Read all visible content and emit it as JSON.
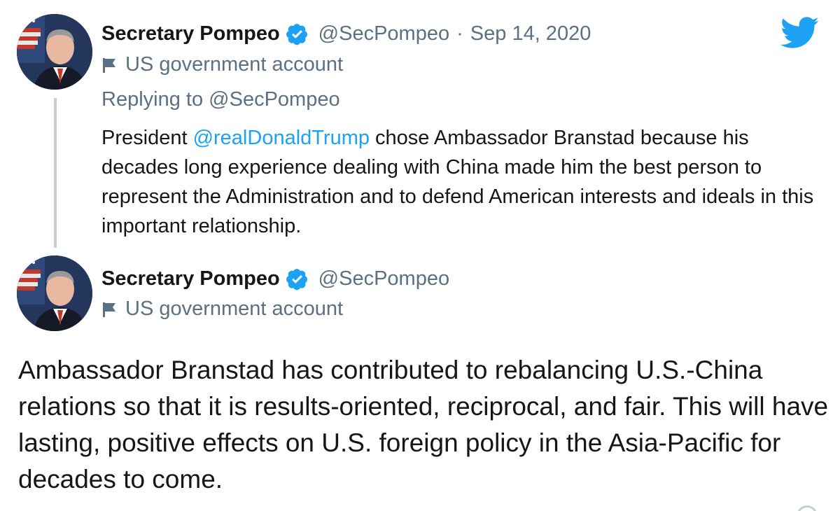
{
  "colors": {
    "brand_blue": "#1da1f2",
    "secondary_text": "#5b7083",
    "primary_text": "#14171a",
    "thread_line": "#c4cfd6"
  },
  "icons": {
    "logo": "twitter-bird-icon",
    "verified": "verified-badge-icon",
    "government": "flag-icon"
  },
  "tweet_reply": {
    "author_name": "Secretary Pompeo",
    "handle": "@SecPompeo",
    "separator": "·",
    "date": "Sep 14, 2020",
    "account_label": "US government account",
    "replying_prefix": "Replying to",
    "replying_handle": "@SecPompeo",
    "text_before_mention": "President ",
    "mention": "@realDonaldTrump",
    "text_after_mention": " chose Ambassador Branstad because his decades long experience dealing with China made him the best person to represent the Administration and to defend American interests and ideals in this important relationship."
  },
  "tweet_main": {
    "author_name": "Secretary Pompeo",
    "handle": "@SecPompeo",
    "account_label": "US government account",
    "text": "Ambassador Branstad has contributed to rebalancing U.S.-China relations so that it is results-oriented, reciprocal, and fair. This will have lasting, positive effects on U.S. foreign policy in the Asia-Pacific for decades to come."
  }
}
